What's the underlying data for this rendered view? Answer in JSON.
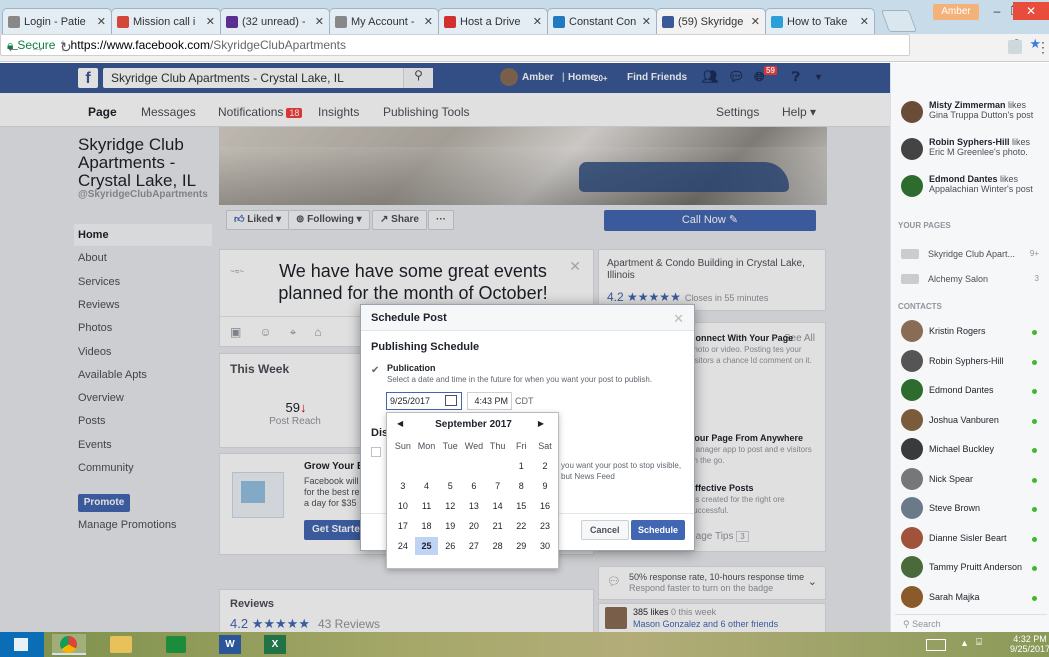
{
  "browser": {
    "tabs": [
      {
        "label": "Login - Patie",
        "icon_color": "#888888",
        "icon": "page-icon"
      },
      {
        "label": "Mission call i",
        "icon_color": "#d44638",
        "icon": "gmail-icon"
      },
      {
        "label": "(32 unread) -",
        "icon_color": "#5b2e91",
        "icon": "mail-icon"
      },
      {
        "label": "My Account -",
        "icon_color": "#888888",
        "icon": "page-icon"
      },
      {
        "label": "Host a Drive",
        "icon_color": "#d32f2f",
        "icon": "drop-icon"
      },
      {
        "label": "Constant Con",
        "icon_color": "#1f7ac1",
        "icon": "cc-icon"
      },
      {
        "label": "(59) Skyridge",
        "icon_color": "#3b5998",
        "icon": "facebook-icon"
      },
      {
        "label": "How to Take",
        "icon_color": "#2a9fd8",
        "icon": "plus-icon"
      }
    ],
    "user": "Amber",
    "url": {
      "secure": "Secure",
      "domain": "https://www.facebook.com",
      "path": "/SkyridgeClubApartments"
    }
  },
  "fb": {
    "search": "Skyridge Club Apartments - Crystal Lake, IL",
    "user": "Amber",
    "home": "Home",
    "home_count": "20+",
    "find_friends": "Find Friends",
    "notif_count": "59"
  },
  "pagenav": {
    "page": "Page",
    "messages": "Messages",
    "notifications": "Notifications",
    "notif_badge": "18",
    "insights": "Insights",
    "publishing": "Publishing Tools",
    "settings": "Settings",
    "help": "Help ▾"
  },
  "left": {
    "page_name": "Skyridge Club Apartments - Crystal Lake, IL",
    "handle": "@SkyridgeClubApartments",
    "nav": [
      "Home",
      "About",
      "Services",
      "Reviews",
      "Photos",
      "Videos",
      "Available Apts",
      "Overview",
      "Posts",
      "Events",
      "Community"
    ],
    "promote": "Promote",
    "manage_promotions": "Manage Promotions"
  },
  "cover_buttons": {
    "liked": "Liked ▾",
    "following": "Following ▾",
    "share": "Share",
    "more": "···",
    "call_now": "Call Now ✎"
  },
  "composer": {
    "text": "We have have some great events planned for the month of October!"
  },
  "this_week": {
    "title": "This Week",
    "value": "59",
    "arrow": "↓",
    "label": "Post Reach"
  },
  "grow": {
    "title": "Grow Your Bu",
    "desc": "Facebook will for the best re a day for $35",
    "button": "Get Started"
  },
  "reviews": {
    "title": "Reviews",
    "rating": "4.2",
    "stars": "★★★★★",
    "count": "43 Reviews"
  },
  "about": {
    "category": "Apartment & Condo Building in Crystal Lake, Illinois",
    "rating": "4.2",
    "stars": "★★★★★",
    "status": "Closes in 55 minutes"
  },
  "tips": {
    "see_all": "See All",
    "items": [
      {
        "title": "Connect With Your Page",
        "text": "photo or video. Posting tes your visitors a chance ld comment on it."
      },
      {
        "title": "Your Page From Anywhere",
        "text": "Manager app to post and e visitors on the go."
      },
      {
        "title": "Effective Posts",
        "text": "sts created for the right ore successful."
      }
    ],
    "page_tips": "Page Tips",
    "page_tips_count": "3"
  },
  "response": {
    "text": "50% response rate, 10-hours response time",
    "sub": "Respond faster to turn on the badge"
  },
  "likes": {
    "count": "385 likes",
    "sub": "0 this week",
    "names": "Mason Gonzalez and 6 other friends"
  },
  "ticker": [
    {
      "name": "Misty Zimmerman",
      "action": "likes Gina Truppa Dutton's post",
      "color": "#6b4b3a"
    },
    {
      "name": "Robin Syphers-Hill",
      "action": "likes Eric M Greenlee's photo.",
      "color": "#444444"
    },
    {
      "name": "Edmond Dantes",
      "action": "likes Appalachian Winter's post",
      "color": "#2e6b2e"
    }
  ],
  "your_pages": {
    "label": "YOUR PAGES",
    "items": [
      {
        "name": "Skyridge Club Apart...",
        "count": "9+"
      },
      {
        "name": "Alchemy Salon",
        "count": "3"
      }
    ]
  },
  "contacts": {
    "label": "CONTACTS",
    "items": [
      {
        "name": "Kristin Rogers",
        "color": "#8a6b54"
      },
      {
        "name": "Robin Syphers-Hill",
        "color": "#555555"
      },
      {
        "name": "Edmond Dantes",
        "color": "#2e6b2e"
      },
      {
        "name": "Joshua Vanburen",
        "color": "#7a5c3a"
      },
      {
        "name": "Michael Buckley",
        "color": "#3a3a3a"
      },
      {
        "name": "Nick Spear",
        "color": "#777777"
      },
      {
        "name": "Steve Brown",
        "color": "#6b7a8a"
      },
      {
        "name": "Dianne Sisler Beart",
        "color": "#a0523a"
      },
      {
        "name": "Tammy Pruitt Anderson",
        "color": "#4a6a3a"
      },
      {
        "name": "Sarah Majka",
        "color": "#8a5a2a"
      }
    ],
    "search": "Search"
  },
  "modal": {
    "title": "Schedule Post",
    "section": "Publishing Schedule",
    "publication": "Publication",
    "desc": "Select a date and time in the future for when you want your post to publish.",
    "date": "9/25/2017",
    "time": "4:43 PM",
    "tz": "CDT",
    "dis": "Dis",
    "stop_text": "you want your post to stop visible, but News Feed",
    "cancel": "Cancel",
    "schedule": "Schedule"
  },
  "picker": {
    "month": "September 2017",
    "days": [
      "Sun",
      "Mon",
      "Tue",
      "Wed",
      "Thu",
      "Fri",
      "Sat"
    ],
    "weeks": [
      [
        "",
        "",
        "",
        "",
        "",
        "1",
        "2"
      ],
      [
        "3",
        "4",
        "5",
        "6",
        "7",
        "8",
        "9"
      ],
      [
        "10",
        "11",
        "12",
        "13",
        "14",
        "15",
        "16"
      ],
      [
        "17",
        "18",
        "19",
        "20",
        "21",
        "22",
        "23"
      ],
      [
        "24",
        "25",
        "26",
        "27",
        "28",
        "29",
        "30"
      ]
    ],
    "selected": "25"
  },
  "taskbar": {
    "time": "4:32 PM",
    "date": "9/25/2017"
  }
}
